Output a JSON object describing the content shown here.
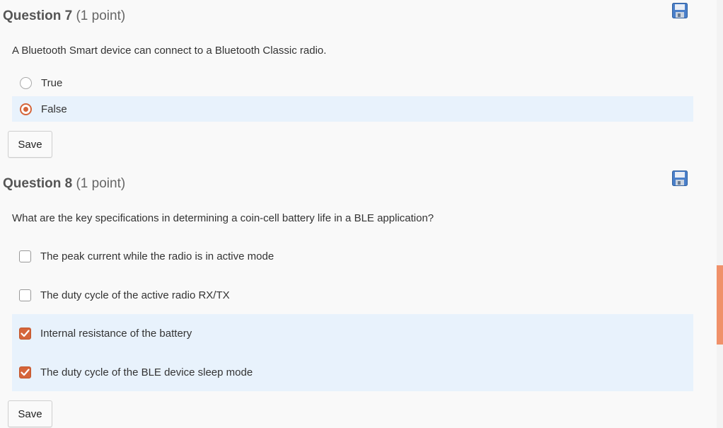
{
  "questions": [
    {
      "number_label": "Question 7",
      "points_label": "(1 point)",
      "text": "A Bluetooth Smart device can connect to a Bluetooth Classic radio.",
      "type": "radio",
      "options": [
        {
          "label": "True",
          "selected": false
        },
        {
          "label": "False",
          "selected": true
        }
      ],
      "save_label": "Save",
      "save_icon": "floppy-disk-icon"
    },
    {
      "number_label": "Question 8",
      "points_label": "(1 point)",
      "text": "What are the key specifications in determining a coin-cell battery life in a BLE application?",
      "type": "checkbox",
      "options": [
        {
          "label": "The peak current while the radio is in active mode",
          "selected": false
        },
        {
          "label": "The duty cycle of the active radio RX/TX",
          "selected": false
        },
        {
          "label": "Internal resistance of the battery",
          "selected": true
        },
        {
          "label": "The duty cycle of the BLE device sleep mode",
          "selected": true
        }
      ],
      "save_label": "Save",
      "save_icon": "floppy-disk-icon"
    }
  ],
  "colors": {
    "accent": "#d5653a",
    "selected_background": "#e8f2fc",
    "save_icon": "#4a7fc9",
    "scrollbar_thumb": "#f0916a"
  }
}
